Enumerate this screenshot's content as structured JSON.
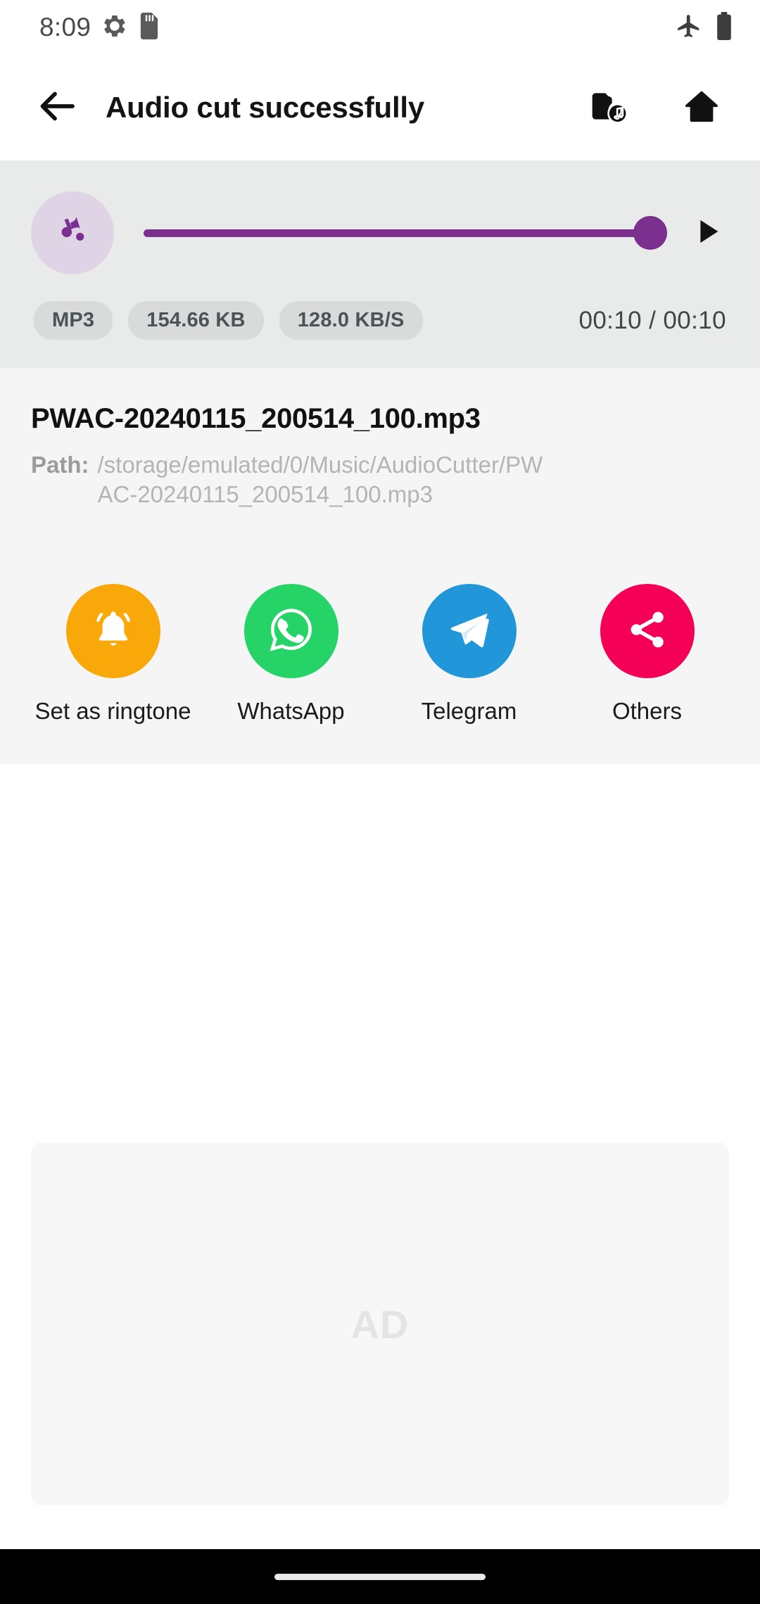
{
  "status_bar": {
    "time": "8:09",
    "icons_left": [
      "gear-icon",
      "sd-card-icon"
    ],
    "icons_right": [
      "airplane-mode-icon",
      "battery-icon"
    ]
  },
  "app_bar": {
    "back_icon": "back-arrow-icon",
    "title": "Audio cut successfully",
    "actions": [
      {
        "name": "music-folder-icon"
      },
      {
        "name": "home-icon"
      }
    ]
  },
  "player": {
    "artwork_icon": "music-note-icon",
    "progress_percent": 100,
    "play_icon": "play-icon",
    "chips": [
      "MP3",
      "154.66 KB",
      "128.0 KB/S"
    ],
    "time": "00:10 / 00:10",
    "current_time": "00:10",
    "total_time": "00:10",
    "accent_color": "#7b2f8f"
  },
  "file": {
    "name": "PWAC-20240115_200514_100.mp3",
    "path_label": "Path:",
    "path_value": "/storage/emulated/0/Music/AudioCutter/PWAC-20240115_200514_100.mp3"
  },
  "share_actions": [
    {
      "label": "Set as ringtone",
      "icon": "bell-icon",
      "color": "#f9a80a"
    },
    {
      "label": "WhatsApp",
      "icon": "whatsapp-icon",
      "color": "#25d366"
    },
    {
      "label": "Telegram",
      "icon": "telegram-icon",
      "color": "#2196d8"
    },
    {
      "label": "Others",
      "icon": "share-icon",
      "color": "#f50057"
    }
  ],
  "ad": {
    "label": "AD"
  },
  "nav_bar": {
    "gesture_pill": "home-gesture-pill"
  }
}
